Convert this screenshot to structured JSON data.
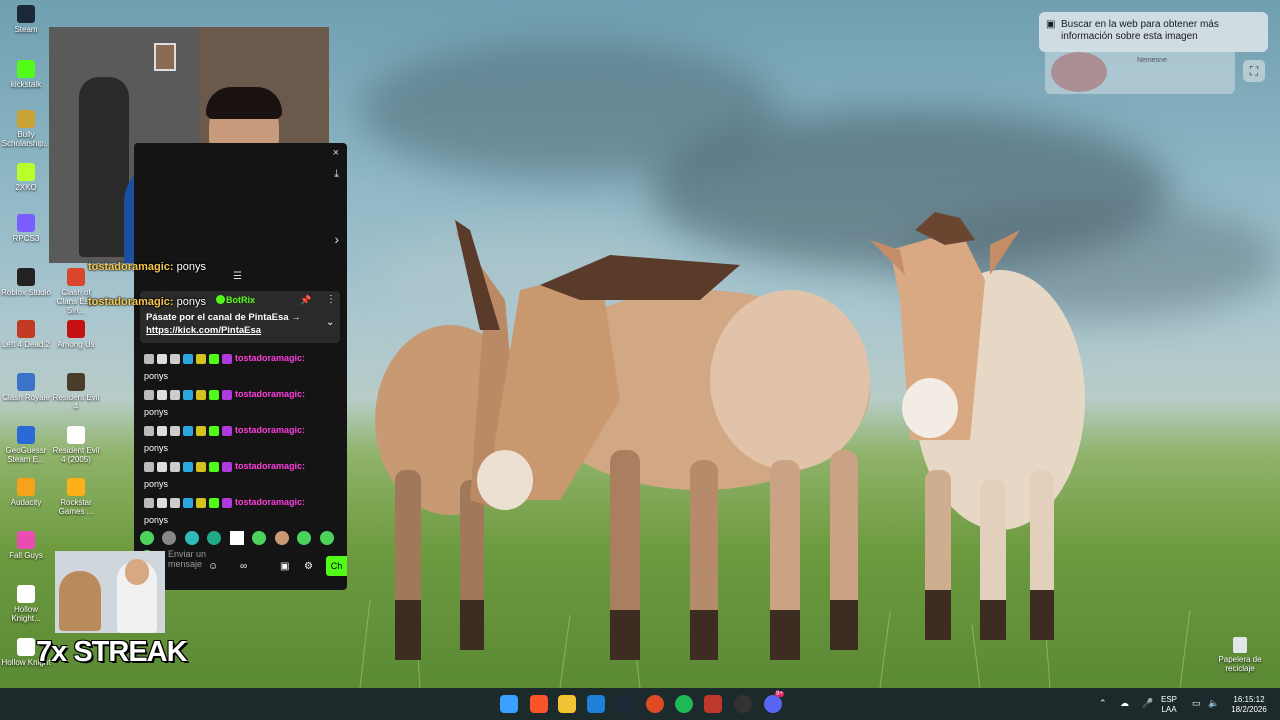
{
  "desktop": {
    "icons": [
      {
        "id": "steam",
        "label": "Steam",
        "color": "#1b2838"
      },
      {
        "id": "kickstalk",
        "label": "kickstalk",
        "color": "#53fc18"
      },
      {
        "id": "bully",
        "label": "Bully Scholarship...",
        "color": "#caa334"
      },
      {
        "id": "2xko",
        "label": "2XKO",
        "color": "#b9ff2a"
      },
      {
        "id": "rpcs3",
        "label": "RPCS3",
        "color": "#7b5cff"
      },
      {
        "id": "roblox",
        "label": "Roblox Studio",
        "color": "#222222"
      },
      {
        "id": "l4d2",
        "label": "Left 4 Dead 2",
        "color": "#c23b22"
      },
      {
        "id": "clashroyale",
        "label": "Clash Royale",
        "color": "#3b73c9"
      },
      {
        "id": "geoguessr",
        "label": "GeoGuessr Steam E...",
        "color": "#2a6ad6"
      },
      {
        "id": "audacity",
        "label": "Audacity",
        "color": "#f7a21b"
      },
      {
        "id": "fallguys",
        "label": "Fall Guys",
        "color": "#e94db3"
      },
      {
        "id": "hollow1",
        "label": "Hollow Knight...",
        "color": "#ffffff"
      },
      {
        "id": "hollow2",
        "label": "Hollow Knight",
        "color": "#ffffff"
      },
      {
        "id": "clash2",
        "label": "Clash of Clans Esp. Sin...",
        "color": "#d9462b"
      },
      {
        "id": "amongus",
        "label": "Among Us",
        "color": "#c51111"
      },
      {
        "id": "re4",
        "label": "Resident Evil 4",
        "color": "#4b3b2b"
      },
      {
        "id": "re4_2005",
        "label": "Resident Evil 4 (2005)",
        "color": "#ffffff"
      },
      {
        "id": "rockstar",
        "label": "Rockstar Games ...",
        "color": "#fcaf17"
      }
    ]
  },
  "overlay_chat": {
    "user": "tostadoramagic:",
    "message": "ponys"
  },
  "chat_popup": {
    "close_icon": "×",
    "pinned": {
      "author": "BotRix",
      "line1": "Pásate por el canal de PintaEsa →",
      "link": "https://kick.com/PintaEsa"
    },
    "messages": [
      {
        "user": "tostadoramagic:",
        "text": "ponys"
      },
      {
        "user": "tostadoramagic:",
        "text": "ponys"
      },
      {
        "user": "tostadoramagic:",
        "text": "ponys"
      },
      {
        "user": "tostadoramagic:",
        "text": "ponys"
      },
      {
        "user": "tostadoramagic:",
        "text": "ponys"
      }
    ],
    "input_placeholder": "Enviar un mensaje",
    "send_label": "Ch"
  },
  "streak": "7x STREAK",
  "lens": {
    "prompt": "Buscar en la web para obtener más información sobre esta imagen",
    "card_title": "Nemesne"
  },
  "recycle_bin": "Papelera de reciclaje",
  "taskbar": {
    "lang_top": "ESP",
    "lang_bottom": "LAA",
    "time": "16:15:12",
    "date": "18/2/2026",
    "discord_badge": "9+"
  }
}
